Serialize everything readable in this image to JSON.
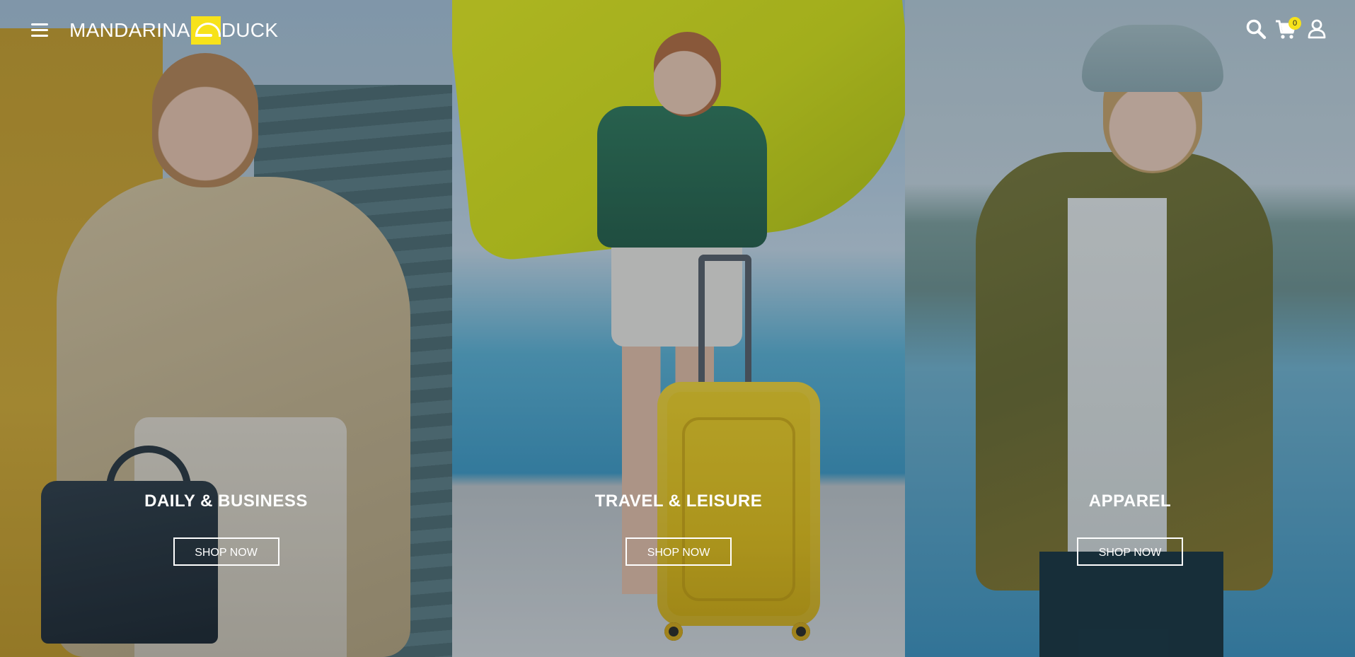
{
  "header": {
    "logo_left": "MANDARINA",
    "logo_right": "DUCK",
    "cart_count": "0",
    "icons": {
      "menu": "hamburger-menu-icon",
      "search": "search-icon",
      "cart": "shopping-cart-icon",
      "account": "user-account-icon"
    }
  },
  "categories": [
    {
      "title": "DAILY & BUSINESS",
      "button": "SHOP NOW"
    },
    {
      "title": "TRAVEL & LEISURE",
      "button": "SHOP NOW"
    },
    {
      "title": "APPAREL",
      "button": "SHOP NOW"
    }
  ],
  "colors": {
    "brand_yellow": "#f7e21a",
    "text_white": "#ffffff"
  }
}
